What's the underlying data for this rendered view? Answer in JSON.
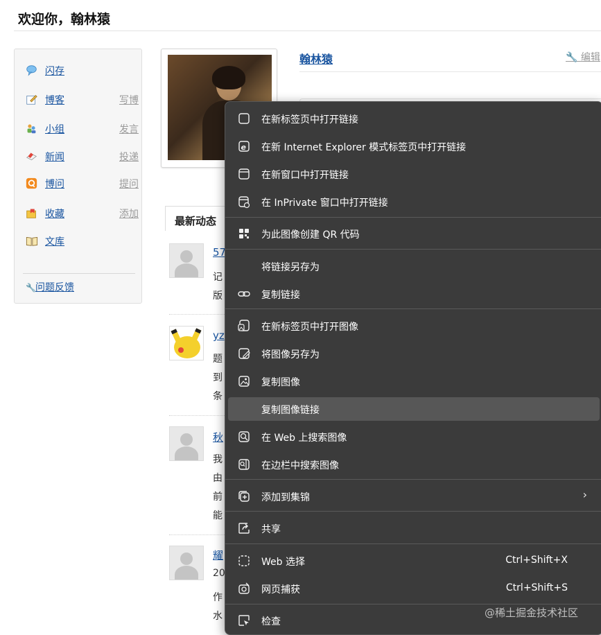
{
  "header": {
    "welcome": "欢迎你，翰林猿"
  },
  "sidebar": {
    "items": [
      {
        "label": "闪存",
        "action": "",
        "icon": "speech-bubble-icon"
      },
      {
        "label": "博客",
        "action": "写博",
        "icon": "blog-pencil-icon"
      },
      {
        "label": "小组",
        "action": "发言",
        "icon": "group-people-icon"
      },
      {
        "label": "新闻",
        "action": "投递",
        "icon": "news-icon"
      },
      {
        "label": "博问",
        "action": "提问",
        "icon": "q-icon"
      },
      {
        "label": "收藏",
        "action": "添加",
        "icon": "favorite-icon"
      },
      {
        "label": "文库",
        "action": "",
        "icon": "book-icon"
      }
    ],
    "feedback": "问题反馈"
  },
  "profile": {
    "name": "翰林猿",
    "edit": "编辑"
  },
  "feed": {
    "tab_label": "最新动态",
    "items": [
      {
        "title": "57",
        "lines": [
          "记",
          "版"
        ],
        "avatar": "placeholder"
      },
      {
        "title": "yz",
        "lines": [
          "题",
          "到",
          "条"
        ],
        "avatar": "pikachu"
      },
      {
        "title": "秋",
        "lines": [
          "我",
          "由",
          "前",
          "能"
        ],
        "avatar": "placeholder"
      },
      {
        "title": "耀",
        "lines": [
          "20",
          "作",
          "水"
        ],
        "avatar": "placeholder"
      }
    ]
  },
  "context_menu": {
    "items": [
      {
        "label": "在新标签页中打开链接",
        "icon": "new-tab-icon"
      },
      {
        "label": "在新 Internet Explorer 模式标签页中打开链接",
        "icon": "internet-explorer-icon"
      },
      {
        "label": "在新窗口中打开链接",
        "icon": "new-window-icon"
      },
      {
        "label": "在 InPrivate 窗口中打开链接",
        "icon": "inprivate-icon"
      },
      {
        "label": "为此图像创建 QR 代码",
        "icon": "qr-code-icon"
      },
      {
        "label": "将链接另存为",
        "icon": ""
      },
      {
        "label": "复制链接",
        "icon": "link-icon"
      },
      {
        "label": "在新标签页中打开图像",
        "icon": "open-image-tab-icon"
      },
      {
        "label": "将图像另存为",
        "icon": "save-image-icon"
      },
      {
        "label": "复制图像",
        "icon": "copy-image-icon"
      },
      {
        "label": "复制图像链接",
        "icon": ""
      },
      {
        "label": "在 Web 上搜索图像",
        "icon": "search-image-web-icon"
      },
      {
        "label": "在边栏中搜索图像",
        "icon": "search-image-sidebar-icon"
      },
      {
        "label": "添加到集锦",
        "icon": "collections-icon"
      },
      {
        "label": "共享",
        "icon": "share-icon"
      },
      {
        "label": "Web 选择",
        "icon": "web-select-icon",
        "shortcut": "Ctrl+Shift+X"
      },
      {
        "label": "网页捕获",
        "icon": "web-capture-icon",
        "shortcut": "Ctrl+Shift+S"
      },
      {
        "label": "检查",
        "icon": "inspect-icon"
      }
    ],
    "submenu_arrow": "›"
  },
  "watermark": "@稀土掘金技术社区"
}
